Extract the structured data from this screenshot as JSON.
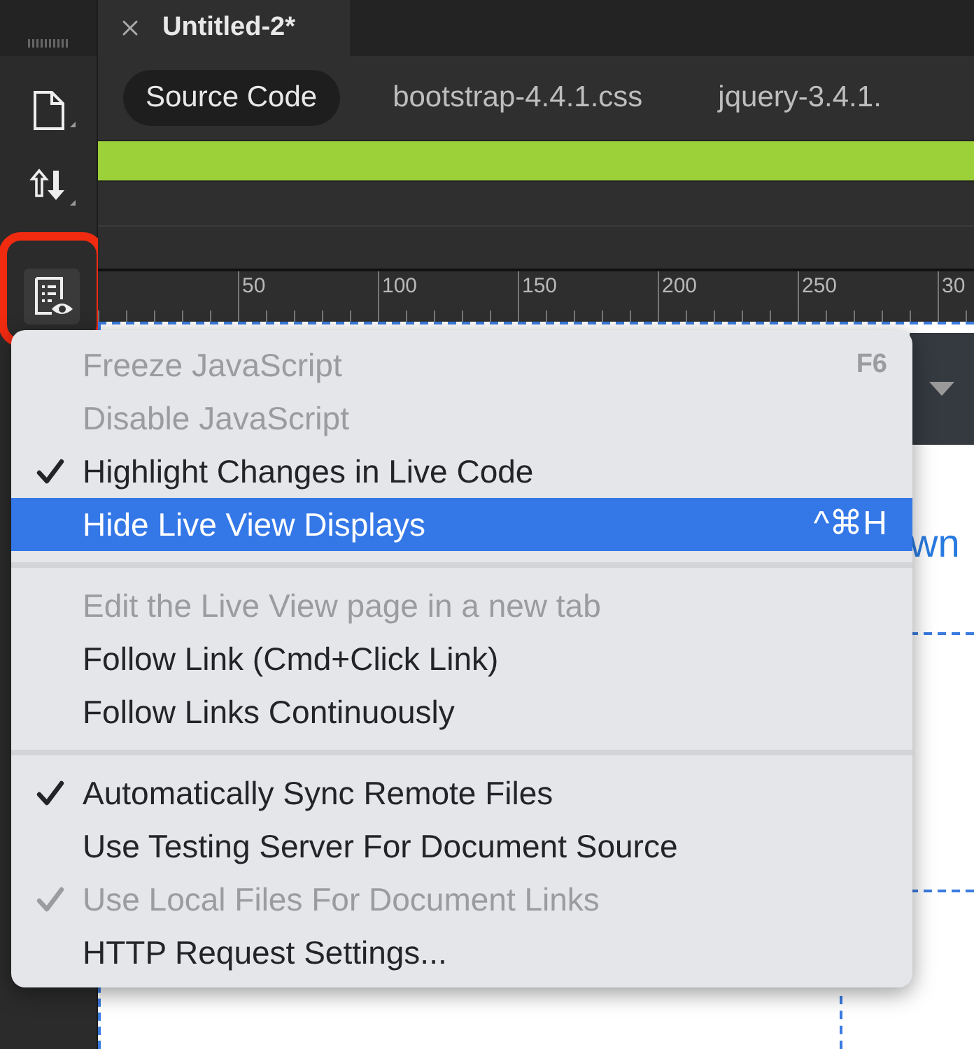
{
  "document_tab": {
    "title": "Untitled-2*"
  },
  "related_files": [
    {
      "label": "Source Code",
      "selected": true
    },
    {
      "label": "bootstrap-4.4.1.css",
      "selected": false
    },
    {
      "label": "jquery-3.4.1.",
      "selected": false
    }
  ],
  "progress": {
    "level": 1
  },
  "ruler": {
    "ticks": [
      "50",
      "100",
      "150",
      "200",
      "250",
      "30"
    ]
  },
  "live_view": {
    "text_fragment": "wn"
  },
  "menu": {
    "items": [
      {
        "kind": "item",
        "label": "Freeze JavaScript",
        "shortcut": "F6",
        "disabled": true,
        "checked": false,
        "selected": false
      },
      {
        "kind": "item",
        "label": "Disable JavaScript",
        "disabled": true,
        "checked": false,
        "selected": false
      },
      {
        "kind": "item",
        "label": "Highlight Changes in Live Code",
        "disabled": false,
        "checked": true,
        "selected": false
      },
      {
        "kind": "item",
        "label": "Hide Live View Displays",
        "shortcut": "^⌘H",
        "disabled": false,
        "checked": false,
        "selected": true
      },
      {
        "kind": "separator"
      },
      {
        "kind": "item",
        "label": "Edit the Live View page in a new tab",
        "disabled": true,
        "checked": false,
        "selected": false
      },
      {
        "kind": "item",
        "label": "Follow Link (Cmd+Click Link)",
        "disabled": false,
        "checked": false,
        "selected": false
      },
      {
        "kind": "item",
        "label": "Follow Links Continuously",
        "disabled": false,
        "checked": false,
        "selected": false
      },
      {
        "kind": "separator"
      },
      {
        "kind": "item",
        "label": "Automatically Sync Remote Files",
        "disabled": false,
        "checked": true,
        "selected": false
      },
      {
        "kind": "item",
        "label": "Use Testing Server For Document Source",
        "disabled": false,
        "checked": false,
        "selected": false
      },
      {
        "kind": "item",
        "label": "Use Local Files For Document Links",
        "disabled": true,
        "checked": true,
        "selected": false
      },
      {
        "kind": "item",
        "label": "HTTP Request Settings...",
        "disabled": false,
        "checked": false,
        "selected": false
      }
    ]
  }
}
